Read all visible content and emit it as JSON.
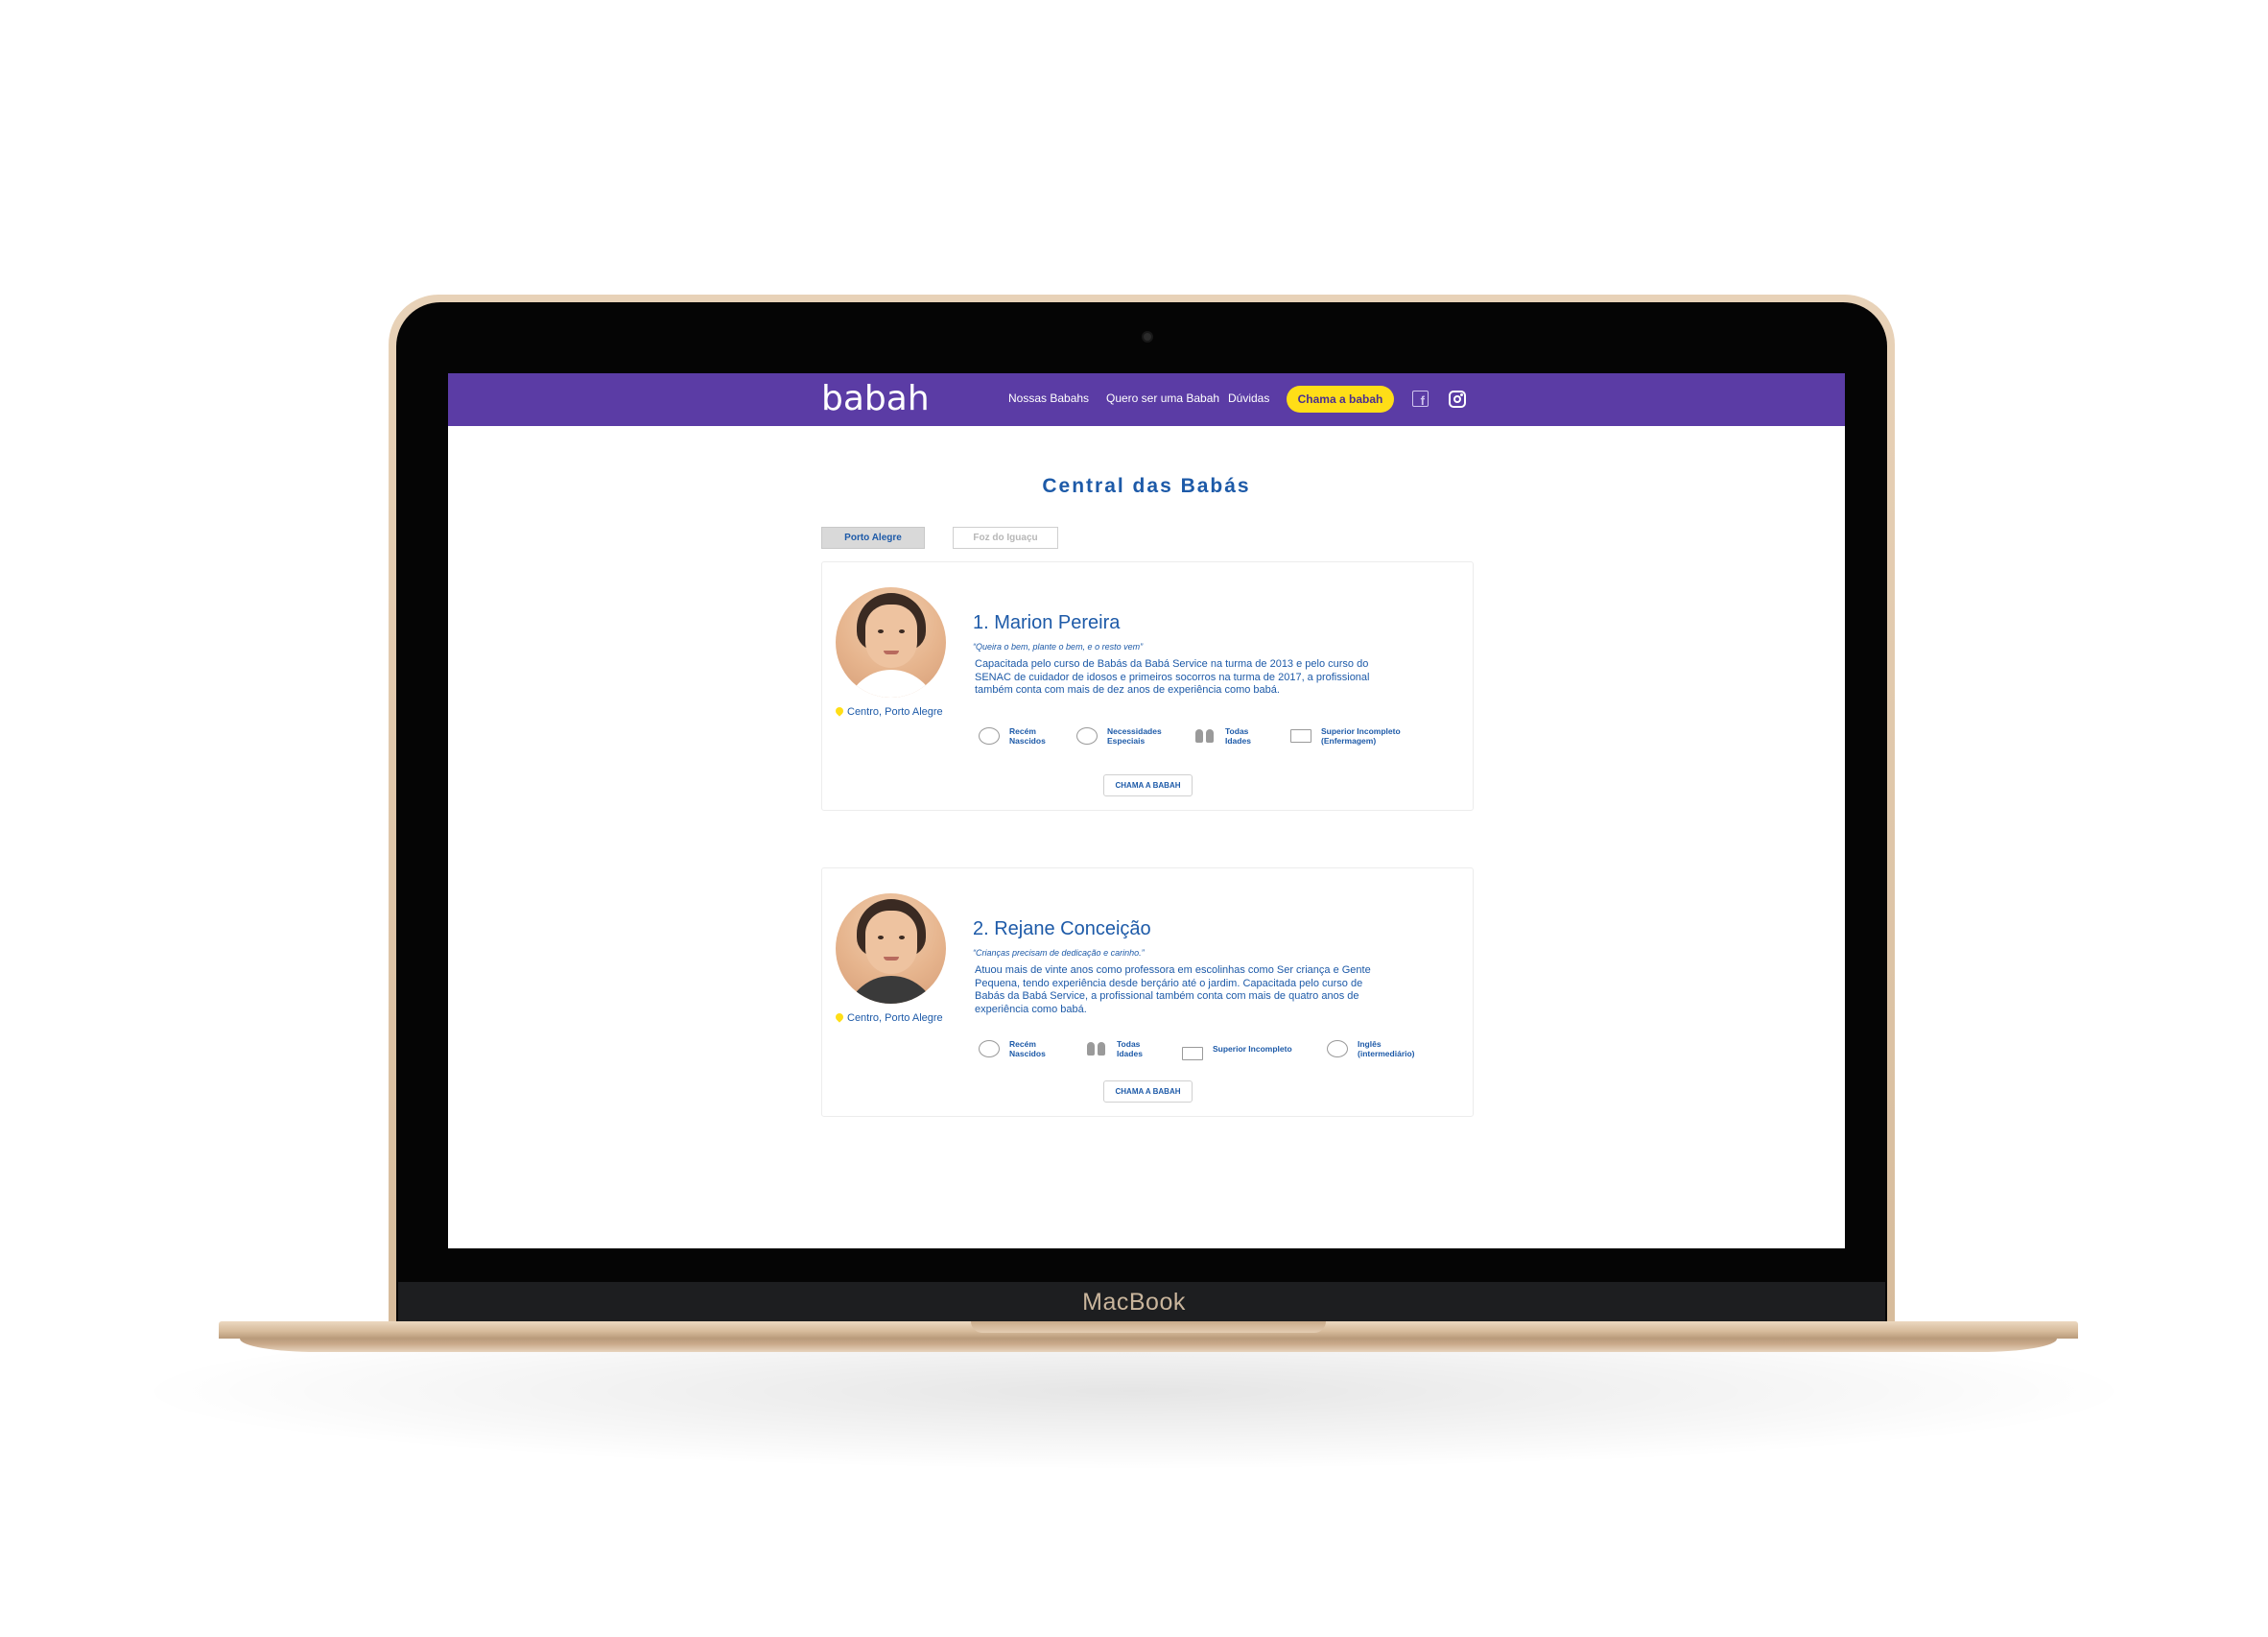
{
  "device": {
    "brand": "MacBook"
  },
  "header": {
    "logo": "babah",
    "nav": [
      "Nossas Babahs",
      "Quero ser uma Babah",
      "Dúvidas"
    ],
    "cta": "Chama a babah",
    "social": [
      "facebook-icon",
      "instagram-icon"
    ]
  },
  "page": {
    "title": "Central das Babás",
    "tabs": [
      {
        "label": "Porto Alegre",
        "active": true
      },
      {
        "label": "Foz do Iguaçu",
        "active": false
      }
    ]
  },
  "nannies": [
    {
      "name": "1. Marion Pereira",
      "quote": "“Queira o bem, plante o bem, e o resto vem”",
      "bio_lines": [
        "Capacitada pelo curso de Babás da Babá Service na turma de 2013 e pelo curso do",
        "SENAC de cuidador de idosos e primeiros socorros na turma de 2017, a profissional",
        "também conta com mais de dez anos de experiência como babá."
      ],
      "location": "Centro, Porto Alegre",
      "features": [
        {
          "icon": "baby-icon",
          "l1": "Recém",
          "l2": "Nascidos"
        },
        {
          "icon": "special-needs-icon",
          "l1": "Necessidades",
          "l2": "Especiais"
        },
        {
          "icon": "children-icon",
          "l1": "Todas",
          "l2": "Idades"
        },
        {
          "icon": "book-icon",
          "l1": "Superior Incompleto",
          "l2": "(Enfermagem)"
        }
      ],
      "cta": "CHAMA A BABAH"
    },
    {
      "name": "2. Rejane Conceição",
      "quote": "“Crianças precisam de dedicação e carinho.”",
      "bio_lines": [
        "Atuou mais de vinte anos como professora em escolinhas como Ser criança e Gente",
        "Pequena, tendo experiência desde berçário até o jardim.  Capacitada pelo curso de",
        "Babás da Babá Service, a profissional também conta com mais de quatro anos de",
        "experiência como babá."
      ],
      "location": "Centro, Porto Alegre",
      "features": [
        {
          "icon": "baby-icon",
          "l1": "Recém",
          "l2": "Nascidos"
        },
        {
          "icon": "children-icon",
          "l1": "Todas",
          "l2": "Idades"
        },
        {
          "icon": "book-icon",
          "l1": "Superior Incompleto",
          "l2": ""
        },
        {
          "icon": "english-icon",
          "l1": "Inglês",
          "l2": "(intermediário)"
        }
      ],
      "cta": "CHAMA A BABAH"
    }
  ]
}
